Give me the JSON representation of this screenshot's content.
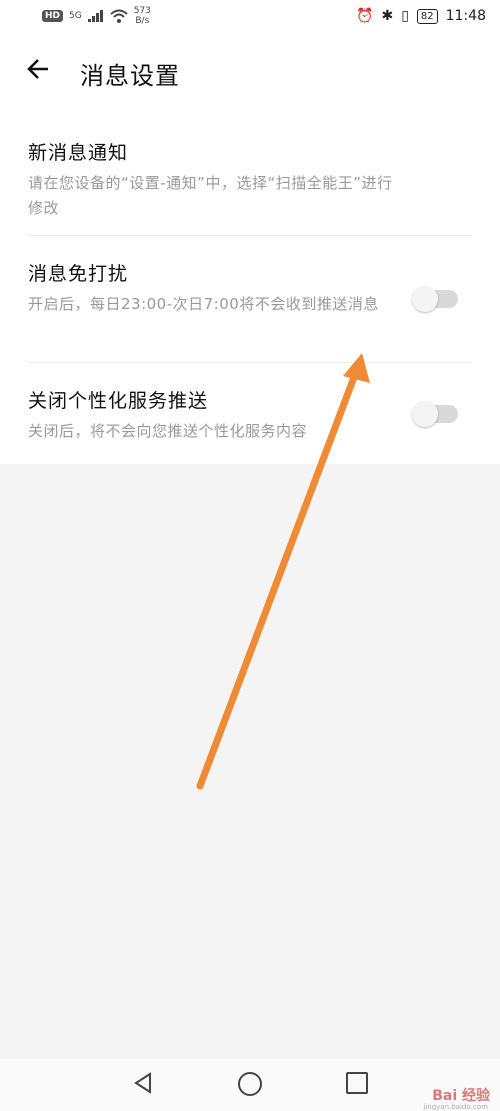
{
  "status_bar": {
    "hd": "HD",
    "signal": "5G",
    "speed_top": "573",
    "speed_bottom": "B/s",
    "battery": "82",
    "time": "11:48"
  },
  "header": {
    "title": "消息设置"
  },
  "items": [
    {
      "title": "新消息通知",
      "desc": "请在您设备的“设置-通知”中，选择“扫描全能王”进行修改"
    },
    {
      "title": "消息免打扰",
      "desc": "开启后，每日23:00-次日7:00将不会收到推送消息",
      "toggle_on": false
    },
    {
      "title": "关闭个性化服务推送",
      "desc": "关闭后，将不会向您推送个性化服务内容",
      "toggle_on": false
    }
  ],
  "watermark": {
    "text": "Bai 经验",
    "sub": "jingyan.baidu.com"
  },
  "colors": {
    "annotation_arrow": "#f08a35",
    "background": "#f4f4f4"
  }
}
